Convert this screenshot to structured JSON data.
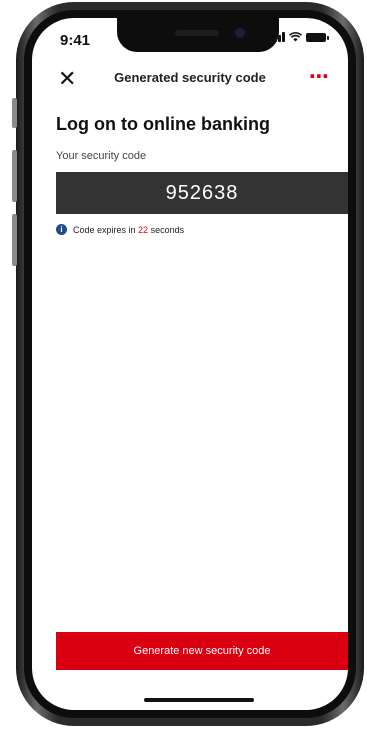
{
  "status": {
    "time": "9:41"
  },
  "nav": {
    "title": "Generated security code",
    "close": "✕",
    "more": "⋯"
  },
  "heading": "Log on to online banking",
  "code_label": "Your security code",
  "code": "952638",
  "expiry": {
    "prefix": "Code expires in ",
    "seconds": "22",
    "suffix": " seconds"
  },
  "button": {
    "label": "Generate new security code"
  },
  "colors": {
    "accent": "#db0011",
    "code_box": "#333333",
    "info": "#1f4e8c"
  }
}
